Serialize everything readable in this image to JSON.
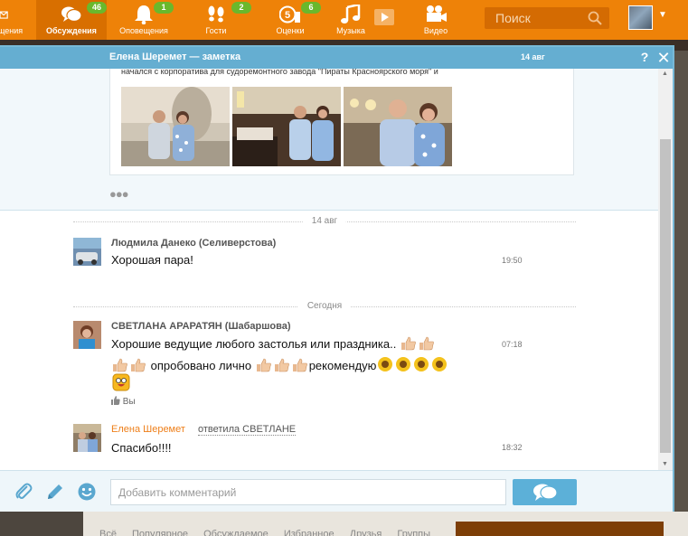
{
  "topbar": {
    "nav": [
      {
        "label": "щения",
        "icon": "envelope-icon",
        "badge": ""
      },
      {
        "label": "Обсуждения",
        "icon": "chat-icon",
        "badge": "46"
      },
      {
        "label": "Оповещения",
        "icon": "bell-icon",
        "badge": "1"
      },
      {
        "label": "Гости",
        "icon": "footprints-icon",
        "badge": "2"
      },
      {
        "label": "Оценки",
        "icon": "rating-icon",
        "badge": "6"
      },
      {
        "label": "Музыка",
        "icon": "music-icon",
        "badge": ""
      },
      {
        "label": "Видео",
        "icon": "video-icon",
        "badge": ""
      }
    ],
    "search_placeholder": "Поиск",
    "accent": "#ee8208",
    "badge_color": "#6ab82c"
  },
  "modal": {
    "title": "Елена Шеремет — заметка",
    "date": "14 авг",
    "note_text": "начался с корпоратива для судоремонтного завода \"Пираты Красноярского моря\" и",
    "photos_count": 3,
    "more_icon": "dots-icon"
  },
  "comments": {
    "separators": [
      "14 авг",
      "Сегодня"
    ],
    "items": [
      {
        "author": "Людмила Данеко (Селиверстова)",
        "line1": "Хорошая пара!",
        "time": "19:50"
      },
      {
        "author": "СВЕТЛАНА АРАРАТЯН (Шабаршова)",
        "line1": "Хорошие ведущие любого застолья или праздника..",
        "line2": "опробовано лично",
        "line2b": "рекомендую",
        "time": "07:18",
        "like": "Вы"
      },
      {
        "author": "Елена Шеремет",
        "reply_to": "ответила СВЕТЛАНЕ",
        "line1": "Спасибо!!!!",
        "time": "18:32"
      }
    ]
  },
  "composer": {
    "placeholder": "Добавить комментарий",
    "icons": [
      "attach-icon",
      "pencil-icon",
      "smiley-icon",
      "send-icon"
    ]
  },
  "background": {
    "tabs": "Всё Популярное Обсуждаемое Избранное Друзья Группы"
  }
}
